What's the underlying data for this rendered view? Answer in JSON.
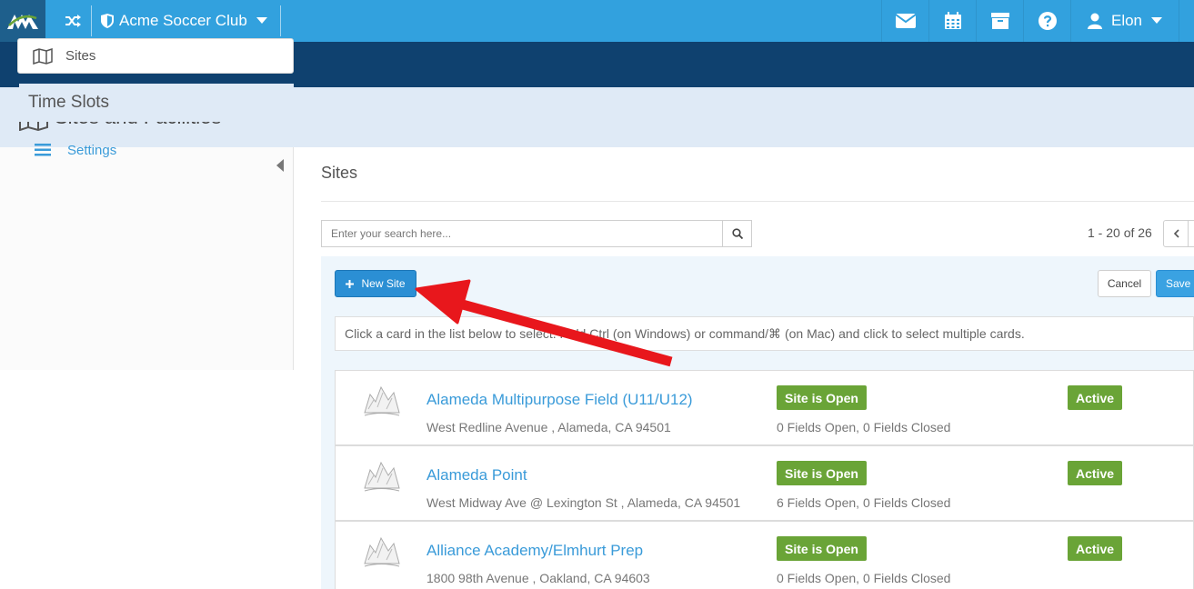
{
  "topbar": {
    "club_name": "Acme Soccer Club",
    "user_name": "Elon"
  },
  "page": {
    "title": "Sites and Facilities"
  },
  "sidebar": {
    "items": [
      {
        "label": "Sites",
        "icon": "map-icon"
      },
      {
        "label": "Time Slots"
      },
      {
        "label": "Settings",
        "icon": "hamburger-icon"
      }
    ]
  },
  "main": {
    "section_title": "Sites",
    "search": {
      "placeholder": "Enter your search here..."
    },
    "pager": {
      "text": "1 - 20 of 26"
    },
    "buttons": {
      "new_site": "New Site",
      "cancel": "Cancel",
      "save": "Save"
    },
    "hint": "Click a card in the list below to select. Hold Ctrl (on Windows) or command/⌘ (on Mac) and click to select multiple cards.",
    "sites": [
      {
        "name": "Alameda Multipurpose Field (U11/U12)",
        "address": "West Redline Avenue , Alameda, CA 94501",
        "status": "Site is Open",
        "fields": "0 Fields Open, 0 Fields Closed",
        "active": "Active"
      },
      {
        "name": "Alameda Point",
        "address": "West Midway Ave @ Lexington St , Alameda, CA 94501",
        "status": "Site is Open",
        "fields": "6 Fields Open, 0 Fields Closed",
        "active": "Active"
      },
      {
        "name": "Alliance Academy/Elmhurt Prep",
        "address": "1800 98th Avenue , Oakland, CA 94603",
        "status": "Site is Open",
        "fields": "0 Fields Open, 0 Fields Closed",
        "active": "Active"
      }
    ]
  },
  "colors": {
    "topbar": "#32a1de",
    "navband": "#0f416f",
    "header": "#dfeaf6",
    "badge_green": "#6aa437",
    "link_blue": "#3a9bd9",
    "annotation_arrow": "#e8171c"
  }
}
